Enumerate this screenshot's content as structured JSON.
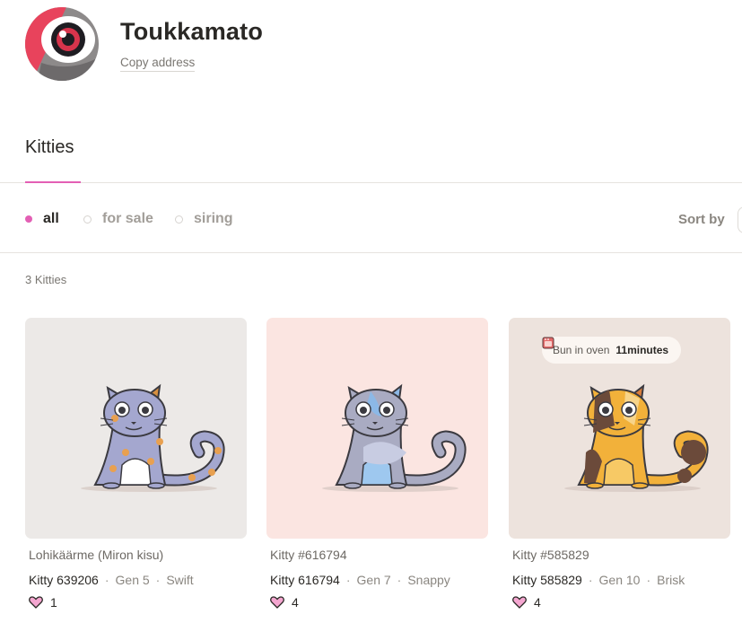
{
  "profile": {
    "name": "Toukkamato",
    "copy_address": "Copy address",
    "avatar_icon": "eye-avatar-icon"
  },
  "tabs": [
    {
      "label": "Kitties",
      "active": true
    }
  ],
  "filters": [
    {
      "label": "all",
      "active": true
    },
    {
      "label": "for sale",
      "active": false
    },
    {
      "label": "siring",
      "active": false
    }
  ],
  "sort": {
    "label": "Sort by"
  },
  "count_text": "3 Kitties",
  "colors": {
    "accent": "#e35fb4",
    "text": "#2a2825",
    "muted": "#8a8680"
  },
  "kitties": [
    {
      "title": "Lohikäärme (Miron kisu)",
      "id_label": "Kitty 639206",
      "gen": "Gen 5",
      "speed": "Swift",
      "likes": "1",
      "bg": "#ece9e7",
      "body_color": "#a4a7cf",
      "spot_color": "#e8a050",
      "belly_color": "#ffffff",
      "ear_color": "#d89040"
    },
    {
      "title": "Kitty #616794",
      "id_label": "Kitty 616794",
      "gen": "Gen 7",
      "speed": "Snappy",
      "likes": "4",
      "bg": "#fbe5e1",
      "body_color": "#a9abc2",
      "spot_color": "#c8cce2",
      "belly_color": "#9ec8ef",
      "ear_color": "#8cb8e6"
    },
    {
      "title": "Kitty #585829",
      "id_label": "Kitty 585829",
      "gen": "Gen 10",
      "speed": "Brisk",
      "likes": "4",
      "bg": "#ede3dd",
      "body_color": "#f2b13a",
      "spot_color": "#6b4a3a",
      "belly_color": "#f7c965",
      "ear_color": "#d97d3b",
      "badge": {
        "prefix": "Bun in oven",
        "time": "11minutes",
        "icon": "oven-icon"
      }
    }
  ]
}
